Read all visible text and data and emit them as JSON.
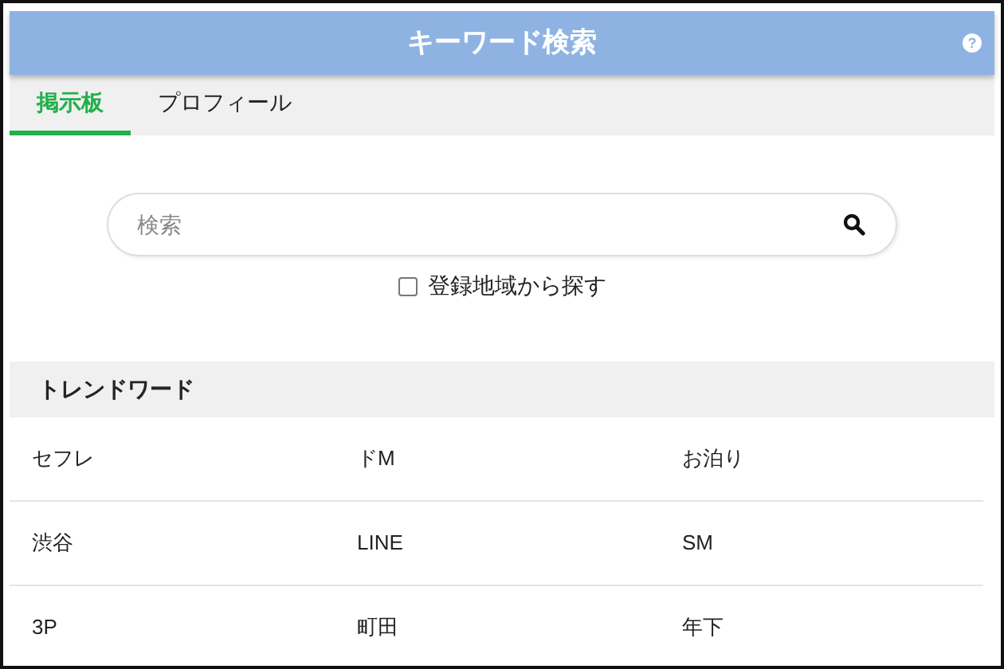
{
  "header": {
    "title": "キーワード検索",
    "help_icon": "?"
  },
  "tabs": [
    {
      "label": "掲示板",
      "selected": true
    },
    {
      "label": "プロフィール",
      "selected": false
    }
  ],
  "search": {
    "placeholder": "検索"
  },
  "region_option": {
    "label": "登録地域から探す",
    "checked": false
  },
  "trend": {
    "title": "トレンドワード",
    "words": [
      "セフレ",
      "ドM",
      "お泊り",
      "渋谷",
      "LINE",
      "SM",
      "3P",
      "町田",
      "年下"
    ]
  }
}
